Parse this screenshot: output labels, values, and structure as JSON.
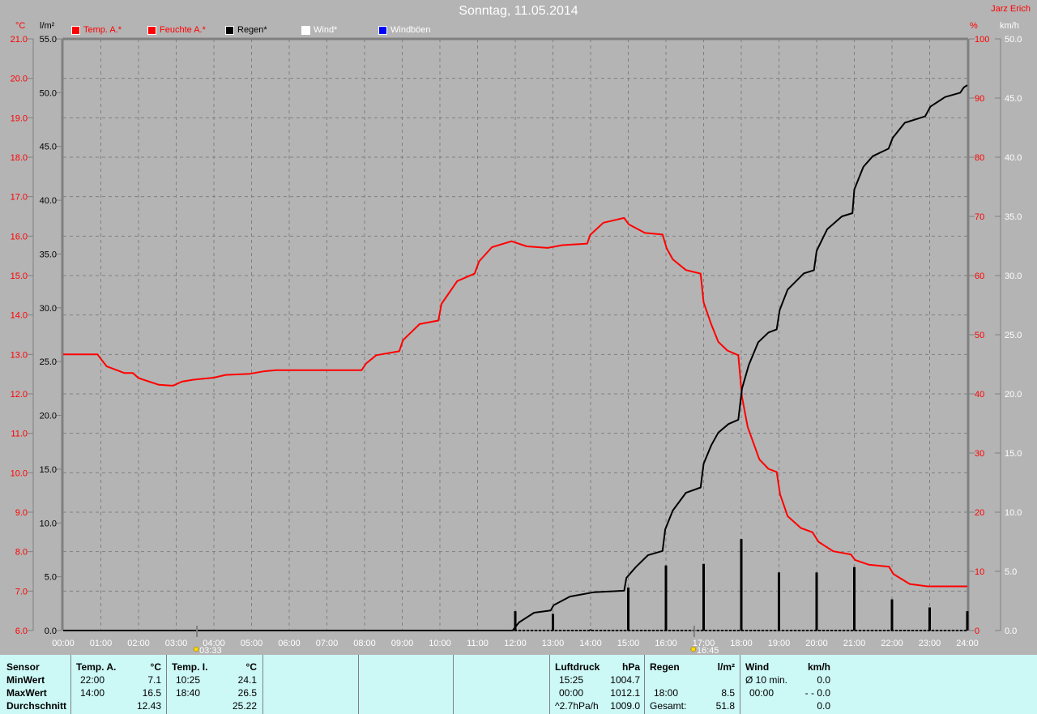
{
  "title": "Sonntag, 11.05.2014",
  "author": "Jarz Erich",
  "units": {
    "temp": "°C",
    "rain": "l/m²",
    "humidity": "%",
    "wind": "km/h"
  },
  "legend": [
    {
      "label": "Temp. A.*",
      "color": "#ff0000",
      "text_color": "#ff0000"
    },
    {
      "label": "Feuchte A.*",
      "color": "#ff0000",
      "text_color": "#ff0000"
    },
    {
      "label": "Regen*",
      "color": "#000000",
      "text_color": "#000000"
    },
    {
      "label": "Wind*",
      "color": "#ffffff",
      "text_color": "#ffffff"
    },
    {
      "label": "Windböen",
      "color": "#0000ff",
      "text_color": "#ffffff"
    }
  ],
  "sun": {
    "sunrise": "03:33",
    "sunset": "16:45"
  },
  "chart_data": {
    "type": "line",
    "grid": true,
    "x_ticks": [
      "00:00",
      "01:00",
      "02:00",
      "03:00",
      "04:00",
      "05:00",
      "06:00",
      "07:00",
      "08:00",
      "09:00",
      "10:00",
      "11:00",
      "12:00",
      "13:00",
      "14:00",
      "15:00",
      "16:00",
      "17:00",
      "18:00",
      "19:00",
      "20:00",
      "21:00",
      "22:00",
      "23:00",
      "24:00"
    ],
    "xlim_hours": [
      0,
      24
    ],
    "axes": {
      "temp": {
        "range": [
          6,
          21
        ],
        "step": 1,
        "color": "#ff0000",
        "decimals": 1
      },
      "rain": {
        "range": [
          0,
          55
        ],
        "step": 5,
        "color": "#000000",
        "decimals": 1
      },
      "humidity": {
        "range": [
          0,
          100
        ],
        "step": 10,
        "color": "#ff0000",
        "decimals": 0
      },
      "wind": {
        "range": [
          0,
          50
        ],
        "step": 5,
        "color": "#ffffff",
        "decimals": 1
      }
    },
    "series": [
      {
        "name": "Temp. A.*",
        "axis": "temp",
        "color": "#ff0000",
        "points": [
          [
            0,
            13.0
          ],
          [
            0.91,
            13.0
          ],
          [
            1.15,
            12.7
          ],
          [
            1.62,
            12.53
          ],
          [
            1.85,
            12.53
          ],
          [
            2.0,
            12.4
          ],
          [
            2.54,
            12.23
          ],
          [
            2.85,
            12.21
          ],
          [
            2.92,
            12.21
          ],
          [
            3.15,
            12.31
          ],
          [
            3.46,
            12.36
          ],
          [
            4.0,
            12.41
          ],
          [
            4.31,
            12.48
          ],
          [
            4.96,
            12.51
          ],
          [
            5.31,
            12.57
          ],
          [
            5.65,
            12.6
          ],
          [
            7.92,
            12.6
          ],
          [
            8.04,
            12.77
          ],
          [
            8.31,
            12.98
          ],
          [
            8.92,
            13.08
          ],
          [
            9.02,
            13.36
          ],
          [
            9.46,
            13.77
          ],
          [
            9.96,
            13.86
          ],
          [
            10.04,
            14.28
          ],
          [
            10.46,
            14.86
          ],
          [
            10.92,
            15.05
          ],
          [
            11.04,
            15.36
          ],
          [
            11.38,
            15.72
          ],
          [
            11.9,
            15.87
          ],
          [
            12.31,
            15.74
          ],
          [
            12.86,
            15.7
          ],
          [
            13.25,
            15.77
          ],
          [
            13.91,
            15.81
          ],
          [
            13.99,
            16.03
          ],
          [
            14.34,
            16.34
          ],
          [
            14.89,
            16.46
          ],
          [
            15.01,
            16.3
          ],
          [
            15.44,
            16.08
          ],
          [
            15.91,
            16.04
          ],
          [
            16.02,
            15.69
          ],
          [
            16.18,
            15.41
          ],
          [
            16.53,
            15.14
          ],
          [
            16.92,
            15.05
          ],
          [
            17.0,
            14.32
          ],
          [
            17.2,
            13.77
          ],
          [
            17.39,
            13.32
          ],
          [
            17.63,
            13.1
          ],
          [
            17.92,
            12.98
          ],
          [
            18.02,
            11.92
          ],
          [
            18.17,
            11.16
          ],
          [
            18.48,
            10.34
          ],
          [
            18.72,
            10.1
          ],
          [
            18.94,
            10.02
          ],
          [
            19.03,
            9.45
          ],
          [
            19.23,
            8.9
          ],
          [
            19.58,
            8.6
          ],
          [
            19.89,
            8.49
          ],
          [
            20.05,
            8.25
          ],
          [
            20.44,
            8.01
          ],
          [
            20.91,
            7.93
          ],
          [
            21.02,
            7.79
          ],
          [
            21.38,
            7.67
          ],
          [
            21.92,
            7.62
          ],
          [
            22.04,
            7.43
          ],
          [
            22.47,
            7.18
          ],
          [
            22.94,
            7.12
          ],
          [
            24,
            7.12
          ]
        ]
      },
      {
        "name": "Regen*",
        "axis": "rain",
        "color": "#000000",
        "points": [
          [
            0,
            0
          ],
          [
            11.93,
            0
          ],
          [
            12.1,
            0.75
          ],
          [
            12.5,
            1.66
          ],
          [
            12.94,
            1.86
          ],
          [
            13.02,
            2.36
          ],
          [
            13.45,
            3.16
          ],
          [
            14.09,
            3.56
          ],
          [
            14.89,
            3.7
          ],
          [
            14.95,
            4.9
          ],
          [
            15.2,
            5.9
          ],
          [
            15.52,
            7.0
          ],
          [
            15.91,
            7.4
          ],
          [
            15.98,
            9.4
          ],
          [
            16.18,
            11.15
          ],
          [
            16.53,
            12.8
          ],
          [
            16.92,
            13.3
          ],
          [
            17.0,
            15.5
          ],
          [
            17.2,
            17.2
          ],
          [
            17.39,
            18.4
          ],
          [
            17.66,
            19.2
          ],
          [
            17.92,
            19.6
          ],
          [
            18.02,
            22.5
          ],
          [
            18.2,
            24.7
          ],
          [
            18.45,
            26.8
          ],
          [
            18.72,
            27.7
          ],
          [
            18.94,
            28.0
          ],
          [
            19.02,
            29.8
          ],
          [
            19.23,
            31.7
          ],
          [
            19.66,
            33.2
          ],
          [
            19.93,
            33.5
          ],
          [
            20.0,
            35.3
          ],
          [
            20.28,
            37.3
          ],
          [
            20.67,
            38.5
          ],
          [
            20.95,
            38.8
          ],
          [
            21.0,
            41.0
          ],
          [
            21.24,
            43.1
          ],
          [
            21.49,
            44.1
          ],
          [
            21.91,
            44.8
          ],
          [
            22.02,
            45.8
          ],
          [
            22.34,
            47.2
          ],
          [
            22.88,
            47.8
          ],
          [
            23.02,
            48.7
          ],
          [
            23.41,
            49.6
          ],
          [
            23.81,
            50.0
          ],
          [
            23.91,
            50.5
          ],
          [
            24,
            50.7
          ]
        ]
      }
    ],
    "hourly_rain_bars": {
      "axis": "rain",
      "color": "#000000",
      "hours": [
        12,
        13,
        14,
        15,
        16,
        17,
        18,
        19,
        20,
        21,
        22,
        23,
        24
      ],
      "values": [
        1.8,
        1.55,
        0.1,
        4.0,
        6.05,
        6.2,
        8.5,
        5.4,
        5.4,
        5.9,
        2.9,
        2.15,
        1.8
      ]
    },
    "wind_series": {
      "name": "Wind*",
      "axis": "wind",
      "value": 0.0
    }
  },
  "table": {
    "row_labels": [
      "Sensor",
      "MinWert",
      "MaxWert",
      "Durchschnitt"
    ],
    "groups": [
      {
        "header": "Temp. A.",
        "unit": "°C",
        "rows": [
          [
            "22:00",
            "7.1"
          ],
          [
            "14:00",
            "16.5"
          ],
          [
            "",
            "12.43"
          ]
        ]
      },
      {
        "header": "Temp. I.",
        "unit": "°C",
        "rows": [
          [
            "10:25",
            "24.1"
          ],
          [
            "18:40",
            "26.5"
          ],
          [
            "",
            "25.22"
          ]
        ]
      },
      {
        "header": "",
        "unit": "",
        "rows": [
          [
            "",
            ""
          ],
          [
            "",
            ""
          ],
          [
            "",
            ""
          ]
        ]
      },
      {
        "header": "",
        "unit": "",
        "rows": [
          [
            "",
            ""
          ],
          [
            "",
            ""
          ],
          [
            "",
            ""
          ]
        ]
      },
      {
        "header": "",
        "unit": "",
        "rows": [
          [
            "",
            ""
          ],
          [
            "",
            ""
          ],
          [
            "",
            ""
          ]
        ]
      },
      {
        "header": "Luftdruck",
        "unit": "hPa",
        "rows": [
          [
            "15:25",
            "1004.7"
          ],
          [
            "00:00",
            "1012.1"
          ],
          [
            "^2.7hPa/h",
            "1009.0"
          ]
        ]
      },
      {
        "header": "Regen",
        "unit": "l/m²",
        "rows": [
          [
            "",
            ""
          ],
          [
            "18:00",
            "8.5"
          ],
          [
            "Gesamt:",
            "51.8"
          ]
        ]
      },
      {
        "header": "Wind",
        "unit": "km/h",
        "rows": [
          [
            "Ø 10 min.",
            "0.0"
          ],
          [
            "00:00",
            "- - 0.0"
          ],
          [
            "",
            "0.0"
          ]
        ]
      }
    ]
  }
}
